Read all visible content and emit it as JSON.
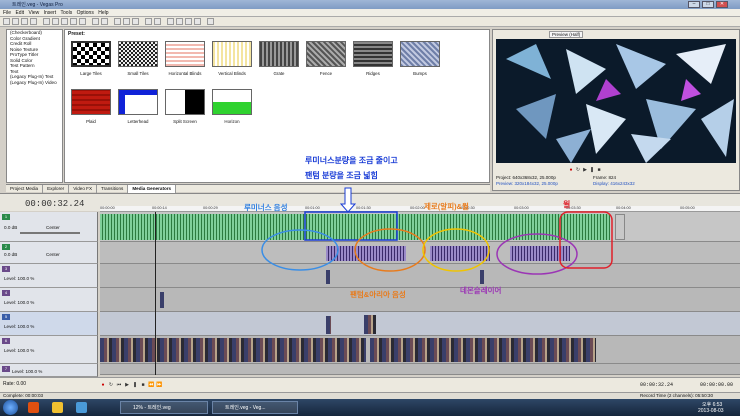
{
  "window": {
    "title": "트레인.veg - Vegas Pro",
    "min": "–",
    "max": "□",
    "close": "✕"
  },
  "menu": [
    "File",
    "Edit",
    "View",
    "Insert",
    "Tools",
    "Options",
    "Help"
  ],
  "tree": {
    "items": [
      "(Checkerboard)",
      "Color Gradient",
      "Credit Roll",
      "Noise Texture",
      "ProType Titler",
      "Solid Color",
      "Test Pattern",
      "Text",
      "(Legacy Plug-In) Text",
      "(Legacy Plug-In) Video"
    ]
  },
  "presets": {
    "header": "Preset:",
    "items": [
      "Large Tiles",
      "Small Tiles",
      "Horizontal Blinds",
      "Vertical Blinds",
      "Grate",
      "Fence",
      "Ridges",
      "Bumps",
      "Plaid",
      "Letterhead",
      "Split Screen",
      "Horizon"
    ]
  },
  "tabs": [
    "Project Media",
    "Explorer",
    "Video FX",
    "Transitions",
    "Media Generators"
  ],
  "preview": {
    "mode": "Preview (Half)",
    "project_label": "Project:",
    "project_value": "640x368x32, 25.000p",
    "preview_label": "Preview:",
    "preview_value": "320x184x32, 25.000p",
    "frame_label": "Frame:",
    "frame_value": "824",
    "display_label": "Display:",
    "display_value": "416x243x32"
  },
  "timeline": {
    "timecode": "00:00:32.24",
    "ruler": [
      "00:00:00",
      "00:00:14",
      "00:00:29",
      "00:01:00",
      "00:01:30",
      "00:02:00",
      "00:02:30",
      "00:03:00",
      "00:03:30",
      "00:04:00",
      "00:05:00"
    ],
    "audio_track": {
      "number": "1",
      "volume": "0.0 dB",
      "pan": "Center"
    },
    "audio_track2": {
      "number": "2",
      "volume": "0.0 dB",
      "pan": "Center"
    },
    "video_tracks": [
      {
        "number": "3",
        "level": "Level: 100.0 %"
      },
      {
        "number": "4",
        "level": "Level: 100.0 %"
      },
      {
        "number": "5",
        "level": "Level: 100.0 %"
      },
      {
        "number": "6",
        "level": "Level: 100.0 %"
      },
      {
        "number": "7",
        "level": "Level: 100.0 %"
      }
    ]
  },
  "annotations": {
    "top_line1": "루미너스분량을 조금 줄이고",
    "top_line2": "팬텀 분량을 조금 넓힘",
    "luminous": "루미너스 음성",
    "zero": "제로(알피)&윌",
    "will": "윌",
    "phantom": "팬텀&아리아 음성",
    "demon": "데몬슬레이어"
  },
  "transport": {
    "rate": "Rate: 0.00",
    "timecode": "00:00:32.24",
    "end": "00:00:00.00"
  },
  "status": {
    "left": "Complete: 00:00:03",
    "right": "Record Time (2 channels): 05:50:30"
  },
  "taskbar": {
    "tasks": [
      "12% - 트레인.veg",
      "트레인.veg - Veg..."
    ],
    "clock_time": "오후 6:53",
    "clock_date": "2013-08-03"
  },
  "colors": {
    "blue_note": "#1a3dd6",
    "orange_note": "#e87b1c",
    "yellow_note": "#f0c400",
    "purple_note": "#9b35b5",
    "red_note": "#e0202a",
    "audio_clip": "#7fcf9a"
  }
}
